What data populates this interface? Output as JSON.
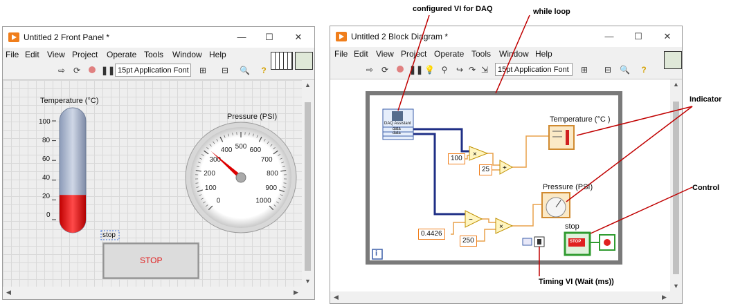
{
  "front_panel": {
    "title": "Untitled 2 Front Panel *",
    "window_controls": {
      "minimize": "—",
      "maximize": "☐",
      "close": "✕"
    },
    "menu": [
      "File",
      "Edit",
      "View",
      "Project",
      "Operate",
      "Tools",
      "Window",
      "Help"
    ],
    "font_selector": "15pt Application Font",
    "temperature": {
      "label": "Temperature (°C)",
      "ticks": [
        "100",
        "80",
        "60",
        "40",
        "20",
        "0"
      ],
      "level": 0.25
    },
    "pressure": {
      "label": "Pressure (PSI)",
      "ticks": [
        "0",
        "100",
        "200",
        "300",
        "400",
        "500",
        "600",
        "700",
        "800",
        "900",
        "1000"
      ],
      "value": 320
    },
    "stop": {
      "label": "stop",
      "button_text": "STOP"
    }
  },
  "block_diagram": {
    "title": "Untitled 2 Block Diagram *",
    "window_controls": {
      "minimize": "—",
      "maximize": "☐",
      "close": "✕"
    },
    "menu": [
      "File",
      "Edit",
      "View",
      "Project",
      "Operate",
      "Tools",
      "Window",
      "Help"
    ],
    "font_selector": "15pt Application Font",
    "daq": {
      "title": "DAQ Assistant",
      "out1": "data",
      "out2": "data"
    },
    "constants": {
      "c100": "100",
      "c25": "25",
      "c04426": "0.4426",
      "c250": "250"
    },
    "temp_indicator_label": "Temperature (°C )",
    "pressure_indicator_label": "Pressure (PSI)",
    "stop_label": "stop",
    "stop_terminal_text": "STOP",
    "loop_iteration": "i"
  },
  "annotations": {
    "daq": "configured VI for DAQ",
    "while_loop": "while loop",
    "indicator": "Indicator",
    "control": "Control",
    "timing": "Timing  VI (Wait (ms))"
  },
  "colors": {
    "labview_orange": "#f07e1b",
    "wire_blue": "#1f2f86",
    "wire_orange": "#e8a04a",
    "annotation_red": "#c00000",
    "stop_red": "#e02020",
    "control_green": "#2f9b2f"
  }
}
